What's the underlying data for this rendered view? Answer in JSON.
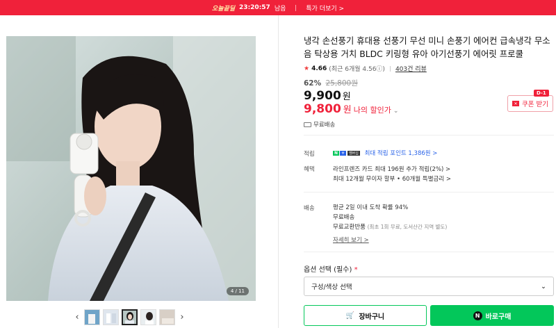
{
  "banner": {
    "deal_label": "오늘끝딜",
    "timer": "23:20:57",
    "remaining": "남음",
    "more_link": "특가 더보기 >"
  },
  "gallery": {
    "counter": "4 / 11",
    "thumb_count": 5,
    "active_index": 2
  },
  "product": {
    "title": "냉각 손선풍기 휴대용 선풍기 무선 미니 손풍기 에어컨 급속냉각 무소음 탁상용 거치 BLDC 키링형 유아 아기선풍기 에어릿 프로쿨",
    "rating": "4.66",
    "rating_sub": "(최근 6개월 4.56ⓘ)",
    "reviews": "403건 리뷰",
    "discount_pct": "62%",
    "original_price": "25,800원",
    "price": "9,900",
    "price_won": "원",
    "my_price": "9,800",
    "my_price_won": "원",
    "my_discount_label": "나의 할인가",
    "coupon_label": "쿠폰 받기",
    "coupon_dday": "D-1",
    "free_shipping": "무료배송"
  },
  "benefits": {
    "points_label": "적립",
    "points_text": "최대 적립 포인트 1,386원 >",
    "benefit_label": "혜택",
    "benefit_line1": "라인프렌즈 카드 최대 196원 추가 적립(2%) >",
    "benefit_line2": "최대 12개월 무이자 할부 • 60개월 특별금리 >",
    "shipping_label": "배송",
    "ship_line1": "평균 2일 이내 도착 확률 94%",
    "ship_line2": "무료배송",
    "ship_line3_main": "무료교환반품",
    "ship_line3_sub": "(최초 1회 무료, 도서산간 지역 별도)",
    "detail_link": "자세히 보기 >"
  },
  "options": {
    "label": "옵션 선택 (필수)",
    "required_mark": "*",
    "select_placeholder": "구성/색상 선택"
  },
  "actions": {
    "cart": "장바구니",
    "buy": "바로구매"
  },
  "colors": {
    "accent_red": "#f0213a",
    "naver_green": "#03c75a",
    "point_blue": "#2a63e8"
  }
}
